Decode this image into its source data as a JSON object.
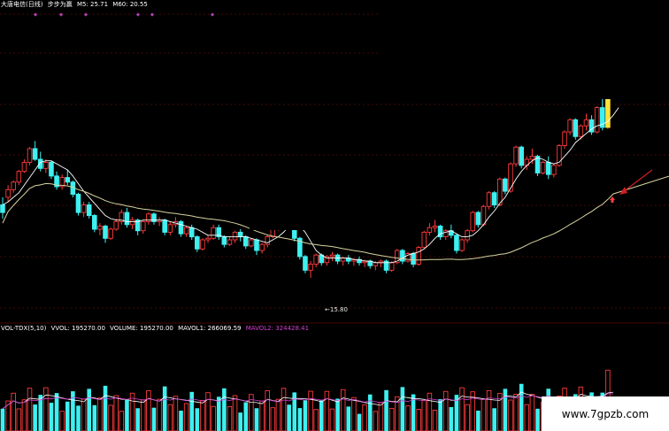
{
  "colors": {
    "background": "#000000",
    "up": "#ff3b3b",
    "down": "#3ef0f0",
    "ma5": "#ffffff",
    "ma60": "#d8d3a0",
    "vol_ma1": "#ffffff",
    "vol_ma2": "#d040d0",
    "grid": "#8a1010",
    "highlight": "#ffe23a",
    "arrow": "#d02020",
    "marker": "#b040b0"
  },
  "header": {
    "title": "大唐电信(日线)",
    "indicator": "步步为赢",
    "ma5_label": "M5: 25.71",
    "ma60_label": "M60: 20.55"
  },
  "volume_header": {
    "indicator": "VOL-TDX(5,10)",
    "vvol": "VVOL: 195270.00",
    "volume": "VOLUME: 195270.00",
    "mavol1": "MAVOL1: 266069.59",
    "mavol2": "MAVOL2: 324428.41"
  },
  "annotations": {
    "low_price": "←15.80"
  },
  "watermark": "www.7gpzb.com",
  "chart_data": {
    "type": "candlestick",
    "price_range": [
      13.0,
      33.5
    ],
    "candles": [
      [
        20.6,
        21.1,
        20.1,
        19.7
      ],
      [
        21.1,
        21.9,
        21.6,
        20.8
      ],
      [
        21.6,
        22.2,
        22.1,
        21.4
      ],
      [
        22.1,
        22.9,
        22.8,
        21.9
      ],
      [
        22.8,
        23.6,
        23.4,
        22.7
      ],
      [
        23.4,
        24.4,
        24.3,
        23.2
      ],
      [
        24.3,
        24.8,
        23.6,
        23.5
      ],
      [
        23.6,
        24.1,
        23.0,
        22.8
      ],
      [
        23.0,
        23.6,
        23.4,
        22.7
      ],
      [
        23.4,
        23.5,
        22.5,
        22.3
      ],
      [
        22.5,
        22.8,
        21.8,
        21.6
      ],
      [
        21.8,
        22.6,
        22.4,
        21.6
      ],
      [
        22.4,
        22.9,
        22.1,
        21.9
      ],
      [
        22.1,
        22.2,
        21.3,
        21.1
      ],
      [
        21.3,
        21.4,
        20.1,
        19.9
      ],
      [
        20.1,
        20.8,
        20.6,
        19.8
      ],
      [
        20.6,
        20.8,
        19.9,
        19.7
      ],
      [
        19.9,
        20.0,
        19.0,
        18.8
      ],
      [
        19.0,
        19.4,
        19.2,
        18.6
      ],
      [
        19.2,
        19.3,
        18.4,
        18.1
      ],
      [
        18.4,
        19.1,
        19.0,
        18.3
      ],
      [
        19.0,
        19.7,
        19.5,
        18.9
      ],
      [
        19.5,
        20.3,
        20.1,
        19.3
      ],
      [
        20.1,
        20.4,
        19.3,
        19.1
      ],
      [
        19.3,
        19.8,
        19.6,
        19.0
      ],
      [
        19.6,
        19.7,
        18.9,
        18.6
      ],
      [
        18.9,
        19.6,
        19.5,
        18.7
      ],
      [
        19.5,
        20.1,
        20.0,
        19.3
      ],
      [
        20.0,
        20.1,
        19.5,
        19.3
      ],
      [
        19.5,
        19.8,
        19.6,
        19.2
      ],
      [
        19.6,
        19.7,
        18.8,
        18.6
      ],
      [
        18.8,
        19.5,
        19.3,
        18.6
      ],
      [
        19.3,
        19.8,
        19.5,
        19.1
      ],
      [
        19.5,
        19.6,
        18.7,
        18.5
      ],
      [
        18.7,
        19.2,
        19.1,
        18.5
      ],
      [
        19.1,
        19.3,
        18.5,
        18.3
      ],
      [
        18.5,
        18.6,
        17.7,
        17.5
      ],
      [
        17.7,
        18.4,
        18.3,
        17.6
      ],
      [
        18.3,
        18.6,
        18.4,
        18.1
      ],
      [
        18.4,
        19.3,
        19.1,
        18.3
      ],
      [
        19.1,
        19.3,
        18.5,
        18.3
      ],
      [
        18.5,
        18.6,
        18.0,
        17.8
      ],
      [
        18.0,
        18.5,
        18.3,
        17.9
      ],
      [
        18.3,
        18.9,
        18.8,
        18.1
      ],
      [
        18.8,
        19.0,
        18.5,
        18.2
      ],
      [
        18.5,
        18.6,
        17.9,
        17.7
      ],
      [
        17.9,
        18.4,
        18.3,
        17.8
      ],
      [
        18.3,
        18.4,
        17.6,
        17.3
      ],
      [
        17.6,
        18.1,
        18.0,
        17.4
      ],
      [
        18.0,
        18.6,
        18.5,
        17.8
      ],
      [
        18.5,
        19.2,
        19.1,
        18.4
      ],
      [
        19.1,
        19.5,
        19.4,
        18.9
      ],
      [
        19.4,
        20.0,
        19.9,
        19.2
      ],
      [
        19.9,
        20.0,
        19.3,
        19.1
      ],
      [
        19.3,
        19.5,
        18.4,
        18.2
      ],
      [
        18.4,
        18.5,
        17.2,
        17.0
      ],
      [
        17.2,
        17.3,
        16.3,
        16.1
      ],
      [
        16.3,
        16.9,
        16.7,
        15.8
      ],
      [
        16.7,
        17.4,
        17.3,
        16.5
      ],
      [
        17.3,
        17.4,
        16.8,
        16.6
      ],
      [
        16.8,
        17.3,
        17.2,
        16.6
      ],
      [
        17.2,
        17.5,
        17.3,
        16.9
      ],
      [
        17.3,
        17.4,
        16.9,
        16.7
      ],
      [
        16.9,
        17.2,
        17.1,
        16.6
      ],
      [
        17.1,
        17.3,
        16.9,
        16.7
      ],
      [
        16.9,
        17.1,
        17.0,
        16.6
      ],
      [
        17.0,
        17.2,
        16.8,
        16.6
      ],
      [
        16.8,
        17.0,
        16.9,
        16.5
      ],
      [
        16.9,
        17.0,
        16.6,
        16.4
      ],
      [
        16.6,
        16.9,
        16.8,
        16.3
      ],
      [
        16.8,
        17.0,
        16.9,
        16.5
      ],
      [
        16.9,
        17.0,
        16.3,
        16.1
      ],
      [
        16.3,
        16.9,
        16.8,
        16.2
      ],
      [
        16.8,
        17.7,
        17.6,
        16.7
      ],
      [
        17.6,
        17.7,
        16.9,
        16.7
      ],
      [
        16.9,
        17.5,
        17.4,
        16.8
      ],
      [
        17.4,
        17.5,
        16.7,
        16.5
      ],
      [
        16.7,
        17.9,
        17.8,
        16.6
      ],
      [
        17.8,
        18.9,
        18.8,
        17.7
      ],
      [
        18.8,
        19.4,
        19.1,
        18.6
      ],
      [
        19.1,
        19.6,
        19.2,
        18.8
      ],
      [
        19.2,
        19.3,
        18.5,
        18.3
      ],
      [
        18.5,
        19.0,
        18.9,
        18.3
      ],
      [
        18.9,
        19.3,
        18.6,
        18.4
      ],
      [
        18.6,
        18.7,
        17.6,
        17.4
      ],
      [
        17.6,
        18.4,
        18.3,
        17.5
      ],
      [
        18.3,
        19.0,
        18.9,
        18.1
      ],
      [
        18.9,
        20.2,
        20.1,
        18.8
      ],
      [
        20.1,
        20.2,
        19.3,
        19.1
      ],
      [
        19.3,
        20.6,
        20.5,
        19.2
      ],
      [
        20.5,
        21.5,
        21.4,
        20.3
      ],
      [
        21.4,
        21.5,
        20.6,
        20.4
      ],
      [
        20.6,
        22.4,
        22.3,
        20.5
      ],
      [
        22.3,
        22.4,
        21.5,
        21.3
      ],
      [
        21.5,
        23.4,
        23.3,
        21.4
      ],
      [
        23.3,
        24.5,
        24.4,
        23.1
      ],
      [
        24.4,
        24.5,
        23.2,
        23.0
      ],
      [
        23.2,
        23.8,
        23.6,
        22.9
      ],
      [
        23.6,
        24.3,
        23.8,
        23.3
      ],
      [
        23.8,
        23.9,
        22.7,
        22.5
      ],
      [
        22.7,
        23.5,
        23.4,
        22.6
      ],
      [
        23.4,
        23.8,
        22.6,
        22.3
      ],
      [
        22.6,
        23.3,
        23.2,
        22.4
      ],
      [
        23.2,
        24.6,
        24.5,
        23.1
      ],
      [
        24.5,
        25.5,
        25.4,
        24.3
      ],
      [
        25.4,
        26.3,
        26.2,
        25.2
      ],
      [
        26.2,
        26.3,
        25.1,
        24.9
      ],
      [
        25.1,
        25.9,
        25.8,
        24.9
      ],
      [
        25.8,
        26.6,
        26.2,
        25.5
      ],
      [
        26.2,
        26.5,
        25.4,
        25.2
      ],
      [
        25.4,
        27.1,
        27.0,
        25.3
      ],
      [
        27.0,
        27.9,
        25.7,
        25.5
      ],
      [
        25.7,
        30.0,
        29.8,
        25.6
      ],
      [
        29.8,
        32.0,
        31.6,
        29.5
      ]
    ],
    "ma5": [
      20.6,
      20.8,
      21.1,
      21.4,
      21.9,
      22.4,
      22.9,
      23.4,
      23.5,
      23.5,
      23.3,
      23.1,
      22.9,
      22.5,
      22.0,
      21.5,
      21.1,
      20.7,
      20.3,
      19.9,
      19.7,
      19.6,
      19.6,
      19.5,
      19.5,
      19.5,
      19.6,
      19.6,
      19.6,
      19.6,
      19.6,
      19.5,
      19.4,
      19.3,
      19.2,
      19.1,
      19.0,
      18.8,
      18.6,
      18.6,
      18.6,
      18.5,
      18.5,
      18.5,
      18.5,
      18.5,
      18.4,
      18.3,
      18.2,
      18.1,
      18.3,
      18.5,
      18.8,
      19.2,
      19.4,
      19.2,
      18.8,
      18.2,
      17.6,
      17.3,
      17.1,
      17.1,
      17.1,
      17.1,
      17.1,
      17.0,
      17.0,
      16.9,
      16.9,
      16.8,
      16.8,
      16.8,
      16.8,
      16.9,
      17.1,
      17.3,
      17.4,
      17.5,
      17.7,
      18.0,
      18.4,
      18.7,
      18.8,
      18.9,
      18.7,
      18.5,
      18.5,
      18.6,
      18.9,
      19.3,
      19.8,
      20.2,
      20.7,
      21.1,
      21.7,
      22.3,
      22.8,
      23.2,
      23.5,
      23.7,
      23.6,
      23.4,
      23.3,
      23.4,
      23.8,
      24.2,
      24.7,
      25.0,
      25.3,
      25.6,
      25.8,
      25.9,
      26.1,
      26.5,
      27.0
    ]
  }
}
